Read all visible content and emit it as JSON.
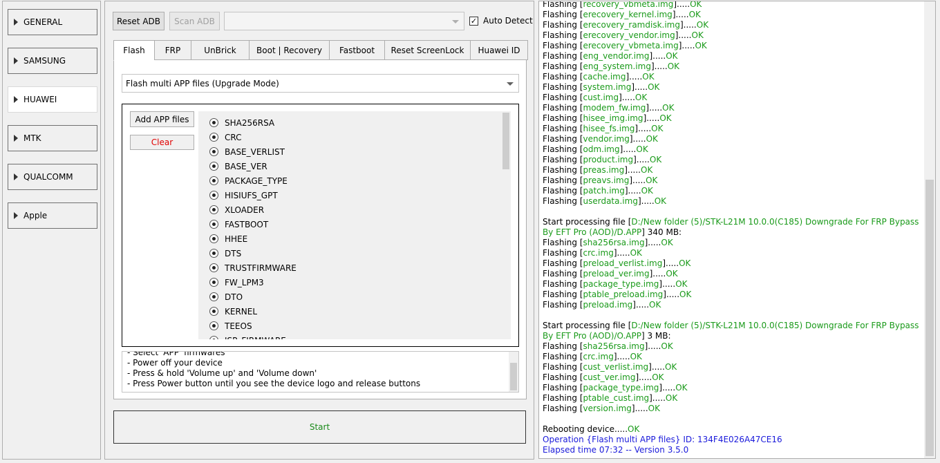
{
  "sidebar": {
    "items": [
      {
        "label": "GENERAL",
        "active": false
      },
      {
        "label": "SAMSUNG",
        "active": false
      },
      {
        "label": "HUAWEI",
        "active": true
      },
      {
        "label": "MTK",
        "active": false
      },
      {
        "label": "QUALCOMM",
        "active": false
      },
      {
        "label": "Apple",
        "active": false
      }
    ]
  },
  "toolbar": {
    "reset_adb": "Reset ADB",
    "scan_adb": "Scan ADB",
    "device_select": "",
    "auto_detect": "Auto Detect",
    "auto_detect_checked": true
  },
  "tabs": [
    {
      "label": "Flash",
      "active": true
    },
    {
      "label": "FRP",
      "active": false
    },
    {
      "label": "UnBrick",
      "active": false
    },
    {
      "label": "Boot | Recovery",
      "active": false
    },
    {
      "label": "Fastboot",
      "active": false
    },
    {
      "label": "Reset ScreenLock",
      "active": false
    },
    {
      "label": "Huawei ID",
      "active": false
    }
  ],
  "flash": {
    "mode": "Flash multi APP files (Upgrade Mode)",
    "add_files": "Add APP files",
    "clear": "Clear",
    "partitions": [
      "SHA256RSA",
      "CRC",
      "BASE_VERLIST",
      "BASE_VER",
      "PACKAGE_TYPE",
      "HISIUFS_GPT",
      "XLOADER",
      "FASTBOOT",
      "HHEE",
      "DTS",
      "TRUSTFIRMWARE",
      "FW_LPM3",
      "DTO",
      "KERNEL",
      "TEEOS",
      "ISP_FIRMWARE"
    ],
    "instructions": [
      "- Select 'APP' firmwares",
      "- Power off your device",
      "- Press & hold 'Volume up' and 'Volume down'",
      "- Press Power button until you see the device logo and release buttons"
    ],
    "start": "Start"
  },
  "log": {
    "lines": [
      {
        "type": "flash",
        "file": "recovery_vbmeta.img"
      },
      {
        "type": "flash",
        "file": "erecovery_kernel.img"
      },
      {
        "type": "flash",
        "file": "erecovery_ramdisk.img"
      },
      {
        "type": "flash",
        "file": "erecovery_vendor.img"
      },
      {
        "type": "flash",
        "file": "erecovery_vbmeta.img"
      },
      {
        "type": "flash",
        "file": "eng_vendor.img"
      },
      {
        "type": "flash",
        "file": "eng_system.img"
      },
      {
        "type": "flash",
        "file": "cache.img"
      },
      {
        "type": "flash",
        "file": "system.img"
      },
      {
        "type": "flash",
        "file": "cust.img"
      },
      {
        "type": "flash",
        "file": "modem_fw.img"
      },
      {
        "type": "flash",
        "file": "hisee_img.img"
      },
      {
        "type": "flash",
        "file": "hisee_fs.img"
      },
      {
        "type": "flash",
        "file": "vendor.img"
      },
      {
        "type": "flash",
        "file": "odm.img"
      },
      {
        "type": "flash",
        "file": "product.img"
      },
      {
        "type": "flash",
        "file": "preas.img"
      },
      {
        "type": "flash",
        "file": "preavs.img"
      },
      {
        "type": "flash",
        "file": "patch.img"
      },
      {
        "type": "flash",
        "file": "userdata.img"
      },
      {
        "type": "blank"
      },
      {
        "type": "process",
        "path": "D:/New folder (5)/STK-L21M 10.0.0(C185) Downgrade For FRP Bypass By EFT Pro (AOD)/D.APP",
        "size": " 340 MB:"
      },
      {
        "type": "flash",
        "file": "sha256rsa.img"
      },
      {
        "type": "flash",
        "file": "crc.img"
      },
      {
        "type": "flash",
        "file": "preload_verlist.img"
      },
      {
        "type": "flash",
        "file": "preload_ver.img"
      },
      {
        "type": "flash",
        "file": "package_type.img"
      },
      {
        "type": "flash",
        "file": "ptable_preload.img"
      },
      {
        "type": "flash",
        "file": "preload.img"
      },
      {
        "type": "blank"
      },
      {
        "type": "process",
        "path": "D:/New folder (5)/STK-L21M 10.0.0(C185) Downgrade For FRP Bypass By EFT Pro (AOD)/O.APP",
        "size": " 3 MB:"
      },
      {
        "type": "flash",
        "file": "sha256rsa.img"
      },
      {
        "type": "flash",
        "file": "crc.img"
      },
      {
        "type": "flash",
        "file": "cust_verlist.img"
      },
      {
        "type": "flash",
        "file": "cust_ver.img"
      },
      {
        "type": "flash",
        "file": "package_type.img"
      },
      {
        "type": "flash",
        "file": "ptable_cust.img"
      },
      {
        "type": "flash",
        "file": "version.img"
      },
      {
        "type": "blank"
      },
      {
        "type": "reboot",
        "text": "Rebooting device.....",
        "ok": "OK"
      },
      {
        "type": "info",
        "text": "Operation {Flash multi APP files} ID: 134F4E026A47CE16"
      },
      {
        "type": "info",
        "text": "Elapsed time 07:32 -- Version 3.5.0"
      }
    ],
    "flash_prefix": "Flashing [",
    "flash_suffix": "].....",
    "ok": "OK",
    "process_prefix": "Start processing file [",
    "process_suffix": "]"
  },
  "colors": {
    "ok": "#1a9a1a",
    "info": "#1a1adb",
    "clear": "#e00000",
    "start": "#1a8a1a"
  }
}
